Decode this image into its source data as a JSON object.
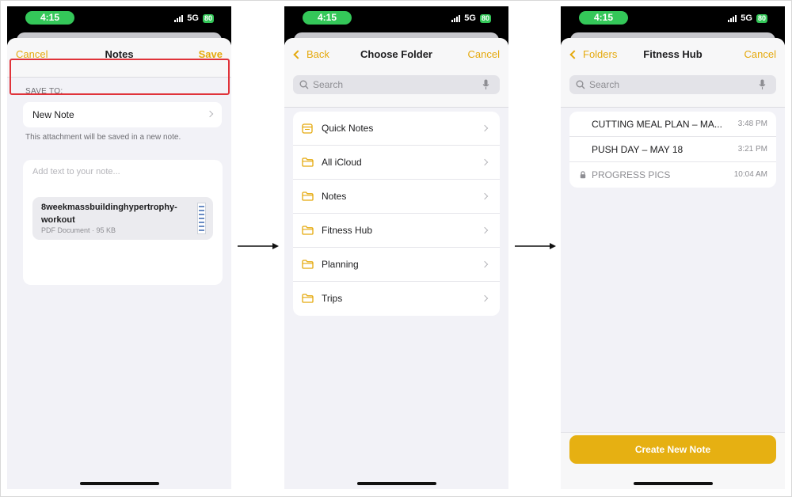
{
  "colors": {
    "accent": "#e5a90c",
    "highlight": "#e0333a",
    "status_green": "#34c759",
    "button": "#e6b012"
  },
  "status": {
    "time": "4:15",
    "network": "5G",
    "battery": "80"
  },
  "screen1": {
    "cancel": "Cancel",
    "title": "Notes",
    "save": "Save",
    "save_to": "SAVE TO:",
    "destination": "New Note",
    "hint": "This attachment will be saved in a new note.",
    "placeholder": "Add text to your note...",
    "attachment": {
      "name": "8weekmassbuildinghypertrophy-workout",
      "meta": "PDF Document · 95 KB",
      "icon": "pdf-thumbnail-icon"
    }
  },
  "screen2": {
    "back": "Back",
    "title": "Choose Folder",
    "cancel": "Cancel",
    "search_placeholder": "Search",
    "folders": [
      {
        "label": "Quick Notes",
        "icon": "quick-notes-icon"
      },
      {
        "label": "All iCloud",
        "icon": "folder-icon"
      },
      {
        "label": "Notes",
        "icon": "folder-icon"
      },
      {
        "label": "Fitness Hub",
        "icon": "folder-icon"
      },
      {
        "label": "Planning",
        "icon": "folder-icon"
      },
      {
        "label": "Trips",
        "icon": "folder-icon"
      }
    ]
  },
  "screen3": {
    "back": "Folders",
    "title": "Fitness Hub",
    "cancel": "Cancel",
    "search_placeholder": "Search",
    "notes": [
      {
        "title": "CUTTING MEAL PLAN – MA...",
        "time": "3:48 PM",
        "locked": false
      },
      {
        "title": "PUSH DAY – MAY 18",
        "time": "3:21 PM",
        "locked": false
      },
      {
        "title": "PROGRESS PICS",
        "time": "10:04 AM",
        "locked": true
      }
    ],
    "create_button": "Create New Note"
  }
}
